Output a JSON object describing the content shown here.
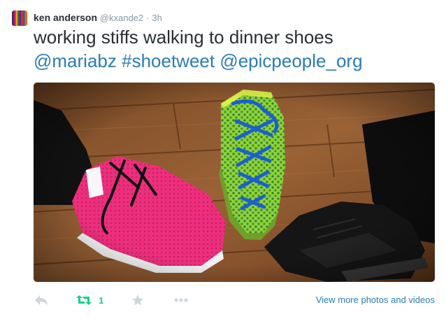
{
  "tweet": {
    "fullname": "ken anderson",
    "username": "@kxande2",
    "separator": "·",
    "time": "3h",
    "text_line1": "working stiffs walking to dinner shoes",
    "mention1": "@mariabz",
    "hashtag": "#shoetweet",
    "mention2": "@epicpeople_org",
    "photo_icon": "photo-shoes-icon"
  },
  "actions": {
    "reply_icon": "reply-icon",
    "retweet_icon": "retweet-icon",
    "retweet_count": "1",
    "favorite_icon": "star-icon",
    "more_icon": "ellipsis-icon",
    "view_more_label": "View more photos and videos"
  },
  "colors": {
    "link": "#2b7bb9",
    "retweet": "#19cf86",
    "muted": "#8899a6",
    "icon": "#ccd6dd"
  }
}
